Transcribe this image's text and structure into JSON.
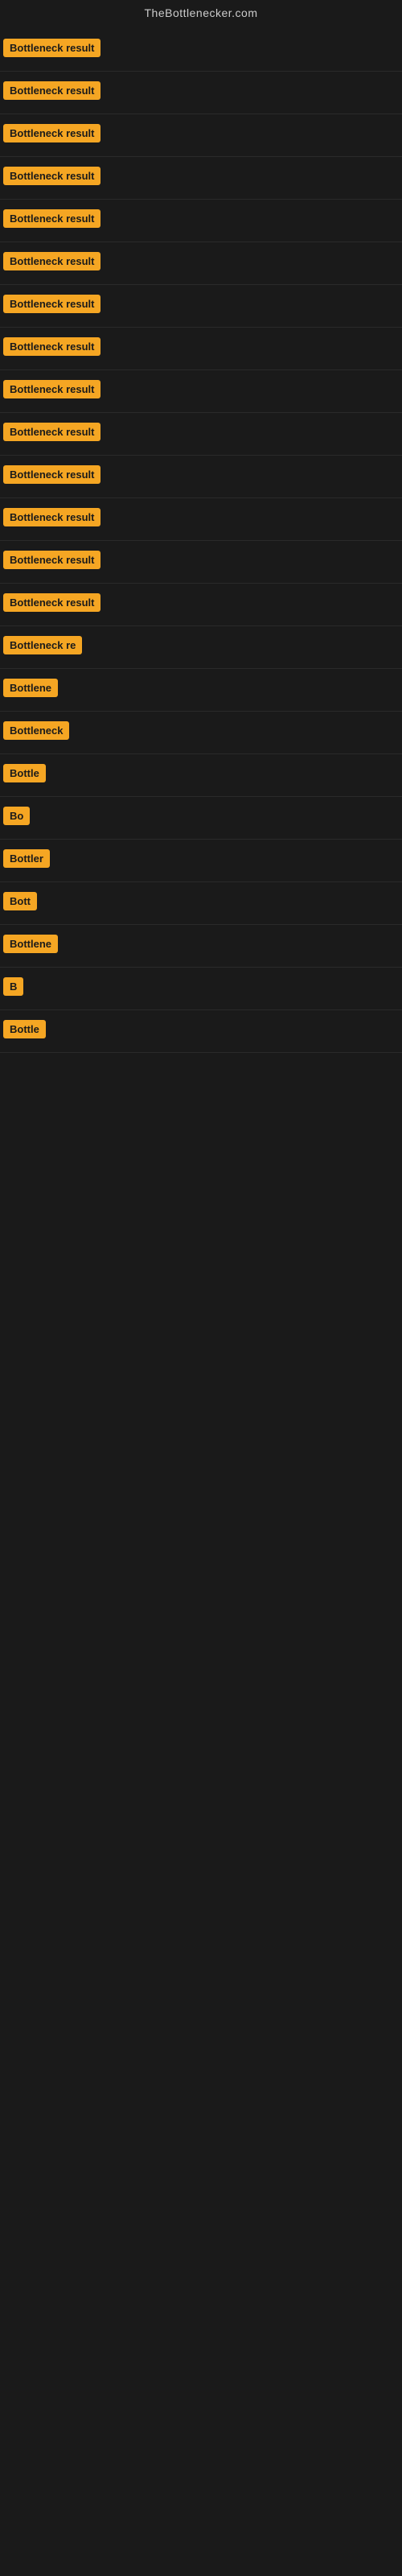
{
  "header": {
    "title": "TheBottlenecker.com"
  },
  "results": [
    {
      "id": 1,
      "label": "Bottleneck result",
      "visible_text": "Bottleneck result"
    },
    {
      "id": 2,
      "label": "Bottleneck result",
      "visible_text": "Bottleneck result"
    },
    {
      "id": 3,
      "label": "Bottleneck result",
      "visible_text": "Bottleneck result"
    },
    {
      "id": 4,
      "label": "Bottleneck result",
      "visible_text": "Bottleneck result"
    },
    {
      "id": 5,
      "label": "Bottleneck result",
      "visible_text": "Bottleneck result"
    },
    {
      "id": 6,
      "label": "Bottleneck result",
      "visible_text": "Bottleneck result"
    },
    {
      "id": 7,
      "label": "Bottleneck result",
      "visible_text": "Bottleneck result"
    },
    {
      "id": 8,
      "label": "Bottleneck result",
      "visible_text": "Bottleneck result"
    },
    {
      "id": 9,
      "label": "Bottleneck result",
      "visible_text": "Bottleneck result"
    },
    {
      "id": 10,
      "label": "Bottleneck result",
      "visible_text": "Bottleneck result"
    },
    {
      "id": 11,
      "label": "Bottleneck result",
      "visible_text": "Bottleneck result"
    },
    {
      "id": 12,
      "label": "Bottleneck result",
      "visible_text": "Bottleneck result"
    },
    {
      "id": 13,
      "label": "Bottleneck result",
      "visible_text": "Bottleneck result"
    },
    {
      "id": 14,
      "label": "Bottleneck result",
      "visible_text": "Bottleneck result"
    },
    {
      "id": 15,
      "label": "Bottleneck result",
      "visible_text": "Bottleneck re"
    },
    {
      "id": 16,
      "label": "Bottleneck result",
      "visible_text": "Bottlene"
    },
    {
      "id": 17,
      "label": "Bottleneck result",
      "visible_text": "Bottleneck"
    },
    {
      "id": 18,
      "label": "Bottleneck result",
      "visible_text": "Bottle"
    },
    {
      "id": 19,
      "label": "Bottleneck result",
      "visible_text": "Bo"
    },
    {
      "id": 20,
      "label": "Bottleneck result",
      "visible_text": "Bottler"
    },
    {
      "id": 21,
      "label": "Bottleneck result",
      "visible_text": "Bott"
    },
    {
      "id": 22,
      "label": "Bottleneck result",
      "visible_text": "Bottlene"
    },
    {
      "id": 23,
      "label": "Bottleneck result",
      "visible_text": "B"
    },
    {
      "id": 24,
      "label": "Bottleneck result",
      "visible_text": "Bottle"
    }
  ]
}
